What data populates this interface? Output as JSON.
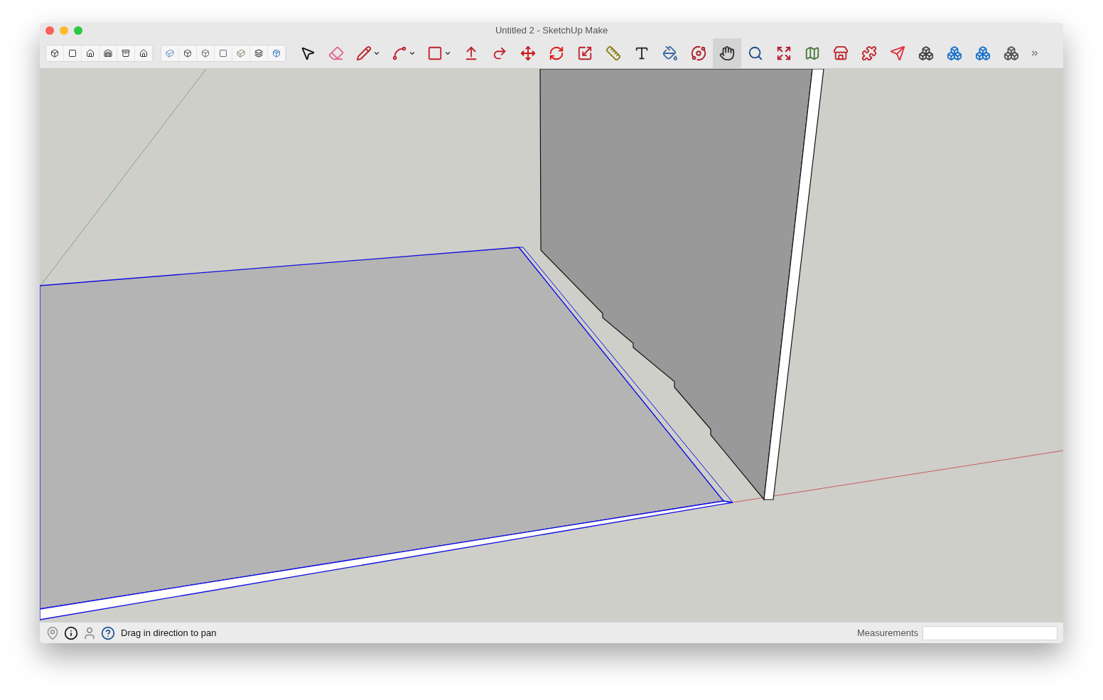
{
  "window": {
    "title": "Untitled 2 - SketchUp Make"
  },
  "view_buttons": [
    {
      "kind": "iso"
    },
    {
      "kind": "top"
    },
    {
      "kind": "front"
    },
    {
      "kind": "right"
    },
    {
      "kind": "back"
    },
    {
      "kind": "left"
    }
  ],
  "style_buttons": [
    {
      "kind": "xray"
    },
    {
      "kind": "backedges"
    },
    {
      "kind": "wireframe"
    },
    {
      "kind": "hidden"
    },
    {
      "kind": "shaded"
    },
    {
      "kind": "textured"
    },
    {
      "kind": "mono"
    }
  ],
  "tools": [
    {
      "kind": "select",
      "selected": false,
      "dropdown": false
    },
    {
      "kind": "eraser",
      "selected": false,
      "dropdown": false
    },
    {
      "kind": "pencil",
      "selected": false,
      "dropdown": true
    },
    {
      "kind": "arc",
      "selected": false,
      "dropdown": true
    },
    {
      "kind": "rectangle",
      "selected": false,
      "dropdown": true
    },
    {
      "kind": "pushpull",
      "selected": false,
      "dropdown": false
    },
    {
      "kind": "offset",
      "selected": false,
      "dropdown": false
    },
    {
      "kind": "move",
      "selected": false,
      "dropdown": false
    },
    {
      "kind": "rotate",
      "selected": false,
      "dropdown": false
    },
    {
      "kind": "scale",
      "selected": false,
      "dropdown": false
    },
    {
      "kind": "tape",
      "selected": false,
      "dropdown": false
    },
    {
      "kind": "text",
      "selected": false,
      "dropdown": false
    },
    {
      "kind": "paint",
      "selected": false,
      "dropdown": false
    },
    {
      "kind": "orbit",
      "selected": false,
      "dropdown": false
    },
    {
      "kind": "pan",
      "selected": true,
      "dropdown": false
    },
    {
      "kind": "zoom",
      "selected": false,
      "dropdown": false
    },
    {
      "kind": "extents",
      "selected": false,
      "dropdown": false
    },
    {
      "kind": "map",
      "selected": false,
      "dropdown": false
    },
    {
      "kind": "warehouse",
      "selected": false,
      "dropdown": false
    },
    {
      "kind": "extension",
      "selected": false,
      "dropdown": false
    },
    {
      "kind": "send",
      "selected": false,
      "dropdown": false
    },
    {
      "kind": "solid1",
      "selected": false,
      "dropdown": false
    },
    {
      "kind": "solid2",
      "selected": false,
      "dropdown": false
    },
    {
      "kind": "solid3",
      "selected": false,
      "dropdown": false
    },
    {
      "kind": "solid4",
      "selected": false,
      "dropdown": false
    }
  ],
  "status_bar": {
    "icons": [
      {
        "kind": "geo"
      },
      {
        "kind": "credits"
      },
      {
        "kind": "account"
      },
      {
        "kind": "help"
      }
    ],
    "message": "Drag in direction to pan",
    "measurements_label": "Measurements"
  }
}
